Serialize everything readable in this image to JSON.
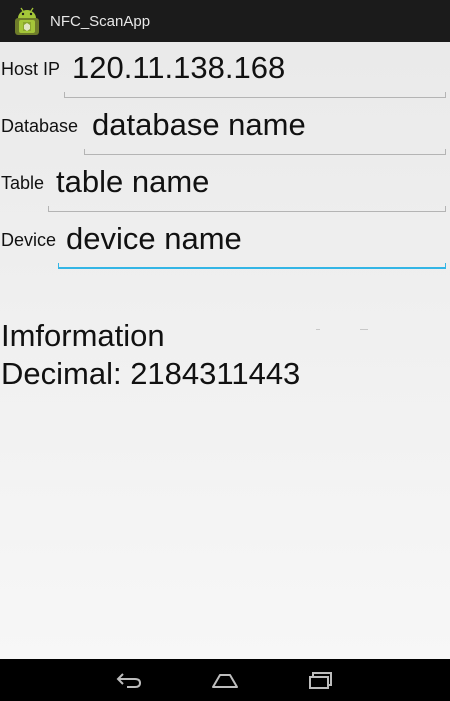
{
  "app": {
    "title": "NFC_ScanApp",
    "icon": "android-robot-icon"
  },
  "form": {
    "host": {
      "label": "Host IP",
      "value": "120.11.138.168"
    },
    "database": {
      "label": "Database",
      "value": "database name"
    },
    "table": {
      "label": "Table",
      "value": "table name"
    },
    "device": {
      "label": "Device",
      "value": "device name",
      "focused": true
    }
  },
  "info": {
    "heading": "Imformation",
    "decimal": "Decimal: 2184311443"
  },
  "nav": {
    "back": "back-icon",
    "home": "home-icon",
    "recents": "recent-apps-icon"
  },
  "colors": {
    "accent": "#33b5e5",
    "action_bar": "#1b1b1b",
    "android_green": "#a4c639"
  }
}
